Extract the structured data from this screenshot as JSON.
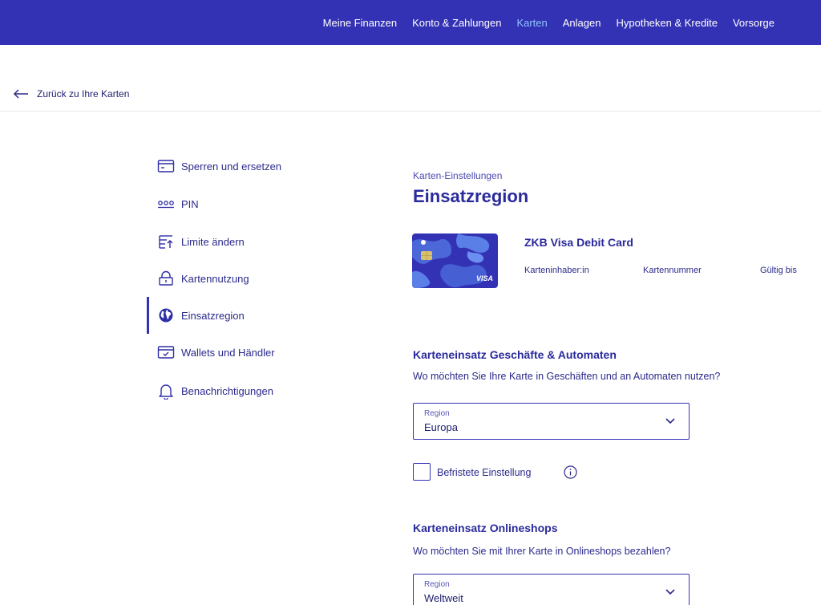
{
  "topnav": {
    "items": [
      {
        "label": "Meine Finanzen"
      },
      {
        "label": "Konto & Zahlungen"
      },
      {
        "label": "Karten",
        "active": true
      },
      {
        "label": "Anlagen"
      },
      {
        "label": "Hypotheken & Kredite"
      },
      {
        "label": "Vorsorge"
      }
    ],
    "background": "#3432b4",
    "active_color": "#8fc4ff"
  },
  "back_link": {
    "label": "Zurück zu Ihre Karten",
    "icon": "arrow-left-icon"
  },
  "sidebar": {
    "items": [
      {
        "label": "Sperren und ersetzen",
        "icon": "card-block-icon"
      },
      {
        "label": "PIN",
        "icon": "pin-dots-icon"
      },
      {
        "label": "Limite ändern",
        "icon": "limit-icon"
      },
      {
        "label": "Kartennutzung",
        "icon": "lock-icon"
      },
      {
        "label": "Einsatzregion",
        "icon": "globe-icon",
        "active": true
      },
      {
        "label": "Wallets und Händler",
        "icon": "wallet-icon"
      },
      {
        "label": "Benachrichtigungen",
        "icon": "bell-icon"
      }
    ]
  },
  "main": {
    "overline": "Karten-Einstellungen",
    "title": "Einsatzregion",
    "card": {
      "name": "ZKB Visa Debit Card",
      "holder_label": "Karteninhaber:in",
      "number_label": "Kartennummer",
      "valid_label": "Gültig bis",
      "brand": "VISA",
      "color": "#3432b4"
    },
    "section_stores": {
      "title": "Karteneinsatz Geschäfte & Automaten",
      "question": "Wo möchten Sie Ihre Karte in Geschäften und an Automaten nutzen?",
      "select": {
        "label": "Region",
        "value": "Europa"
      },
      "checkbox": {
        "label": "Befristete Einstellung",
        "checked": false
      }
    },
    "section_online": {
      "title": "Karteneinsatz Onlineshops",
      "question": "Wo möchten Sie mit Ihrer Karte in Onlineshops bezahlen?",
      "select": {
        "label": "Region",
        "value": "Weltweit"
      }
    }
  }
}
